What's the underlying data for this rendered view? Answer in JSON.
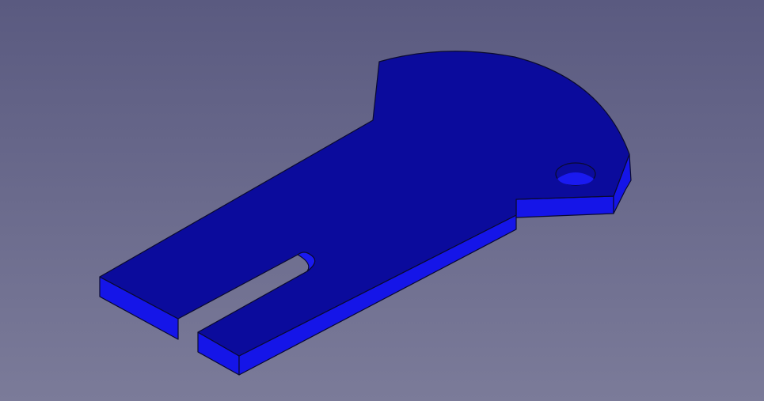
{
  "viewport": {
    "background_top": "#5a5a80",
    "background_bottom": "#7b7b99"
  },
  "part": {
    "top_face_color": "#0b0b9c",
    "side_face_color": "#1515e8",
    "edge_color": "#0a0a30",
    "hole_inner_color": "#1a1af0"
  }
}
